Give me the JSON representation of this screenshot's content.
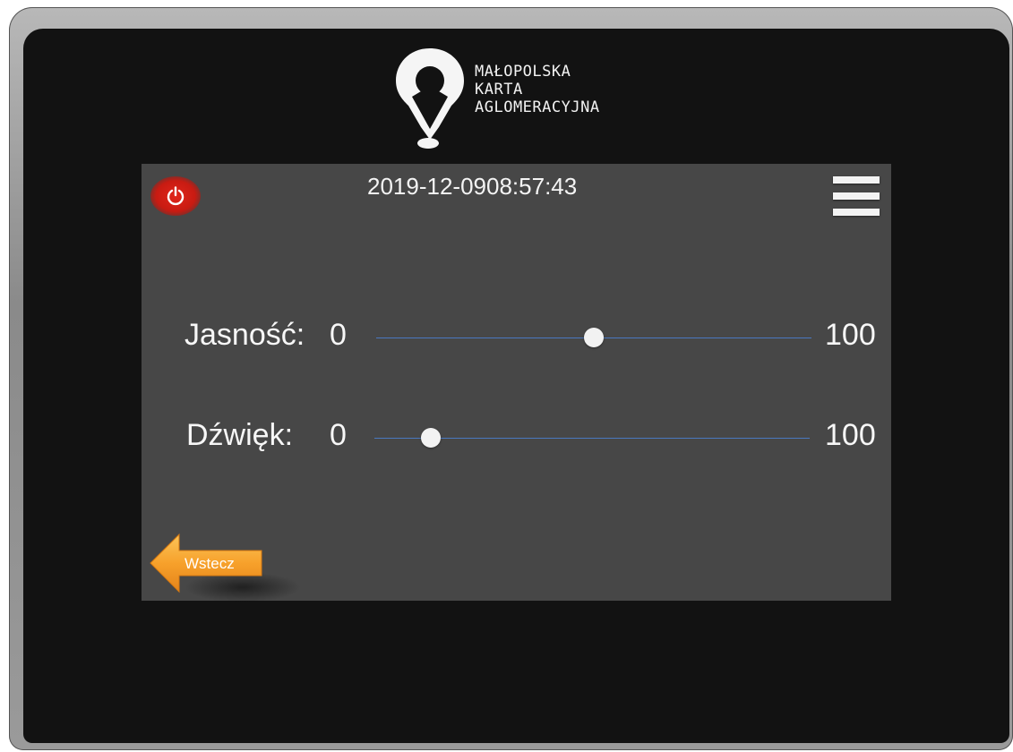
{
  "branding": {
    "logo_icon": "location-pin-logo",
    "lines": [
      "MAŁOPOLSKA",
      "KARTA",
      "AGLOMERACYJNA"
    ]
  },
  "header": {
    "date": "2019-12-09",
    "time": "08:57:43",
    "power_icon": "power-icon",
    "menu_icon": "hamburger-menu-icon"
  },
  "settings": {
    "brightness": {
      "label": "Jasność:",
      "min": "0",
      "max": "100",
      "value": 50
    },
    "sound": {
      "label": "Dźwięk:",
      "min": "0",
      "max": "100",
      "value": 13
    }
  },
  "navigation": {
    "back_label": "Wstecz",
    "back_icon": "arrow-left-icon"
  },
  "colors": {
    "screen_bg": "#474747",
    "power_red": "#d42217",
    "slider_track": "#4a78c0",
    "back_orange": "#f7a12b"
  }
}
